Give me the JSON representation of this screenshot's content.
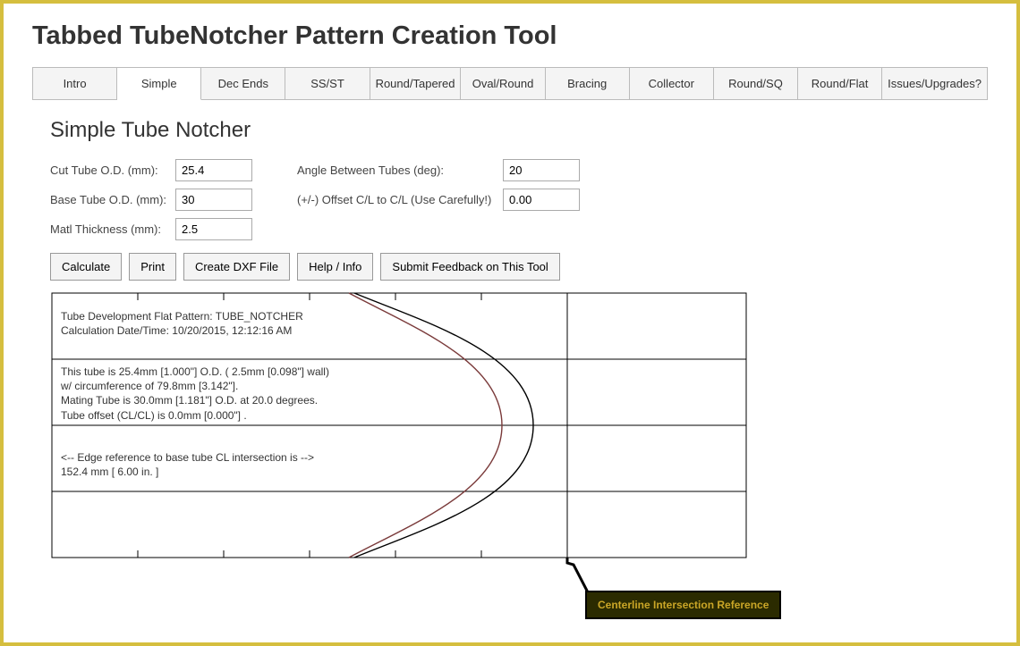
{
  "title": "Tabbed TubeNotcher Pattern Creation Tool",
  "tabs": [
    {
      "label": "Intro"
    },
    {
      "label": "Simple"
    },
    {
      "label": "Dec Ends"
    },
    {
      "label": "SS/ST"
    },
    {
      "label": "Round/Tapered"
    },
    {
      "label": "Oval/Round"
    },
    {
      "label": "Bracing"
    },
    {
      "label": "Collector"
    },
    {
      "label": "Round/SQ"
    },
    {
      "label": "Round/Flat"
    },
    {
      "label": "Issues/Upgrades?"
    }
  ],
  "panel_heading": "Simple Tube Notcher",
  "form": {
    "cut_od_label": "Cut Tube O.D. (mm):",
    "cut_od_value": "25.4",
    "base_od_label": "Base Tube O.D. (mm):",
    "base_od_value": "30",
    "thickness_label": "Matl Thickness (mm):",
    "thickness_value": "2.5",
    "angle_label": "Angle Between Tubes (deg):",
    "angle_value": "20",
    "offset_label": "(+/-) Offset C/L to C/L (Use Carefully!)",
    "offset_value": "0.00"
  },
  "buttons": {
    "calculate": "Calculate",
    "print": "Print",
    "dxf": "Create DXF File",
    "help": "Help / Info",
    "feedback": "Submit Feedback on This Tool"
  },
  "pattern": {
    "title_line1": "Tube Development Flat Pattern: TUBE_NOTCHER",
    "title_line2": "Calculation Date/Time: 10/20/2015, 12:12:16 AM",
    "spec_line1": "This tube is 25.4mm [1.000\"] O.D.     ( 2.5mm [0.098\"] wall)",
    "spec_line2": "       w/ circumference of 79.8mm [3.142\"].",
    "spec_line3": "Mating Tube is 30.0mm [1.181\"] O.D. at 20.0 degrees.",
    "spec_line4": "Tube offset (CL/CL) is 0.0mm [0.000\"] .",
    "edge_ref_line1": "<-- Edge reference to base tube CL intersection is -->",
    "edge_ref_line2": "           152.4 mm   [ 6.00 in. ]",
    "callout": "Centerline Intersection Reference"
  }
}
